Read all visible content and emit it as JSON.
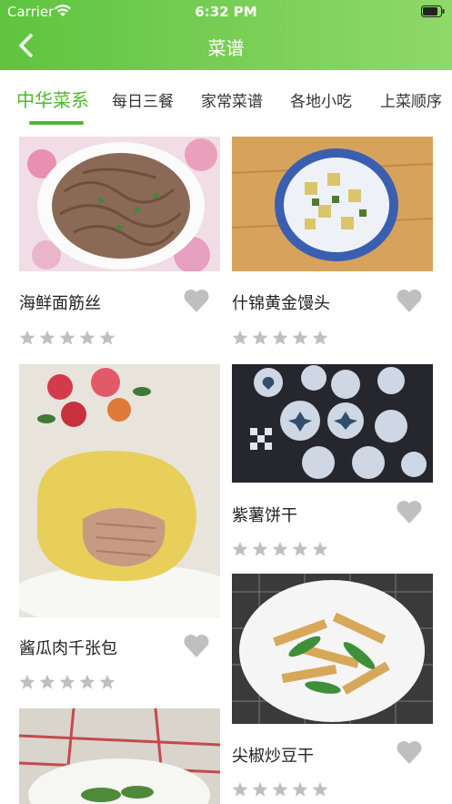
{
  "status_bar": {
    "carrier": "Carrier",
    "time": "6:32 PM"
  },
  "header": {
    "title": "菜谱"
  },
  "tabs": [
    {
      "label": "中华菜系",
      "active": true
    },
    {
      "label": "每日三餐",
      "active": false
    },
    {
      "label": "家常菜谱",
      "active": false
    },
    {
      "label": "各地小吃",
      "active": false
    },
    {
      "label": "上菜顺序",
      "active": false
    }
  ],
  "recipes": [
    {
      "name": "海鲜面筋丝",
      "rating": 0
    },
    {
      "name": "什锦黄金馒头",
      "rating": 0
    },
    {
      "name": "酱瓜肉千张包",
      "rating": 0
    },
    {
      "name": "紫薯饼干",
      "rating": 0
    },
    {
      "name": "尖椒炒豆干",
      "rating": 0
    }
  ],
  "colors": {
    "brand": "#5fc43f",
    "active_tab": "#4fb82c",
    "icon_gray": "#bfbfbf"
  }
}
